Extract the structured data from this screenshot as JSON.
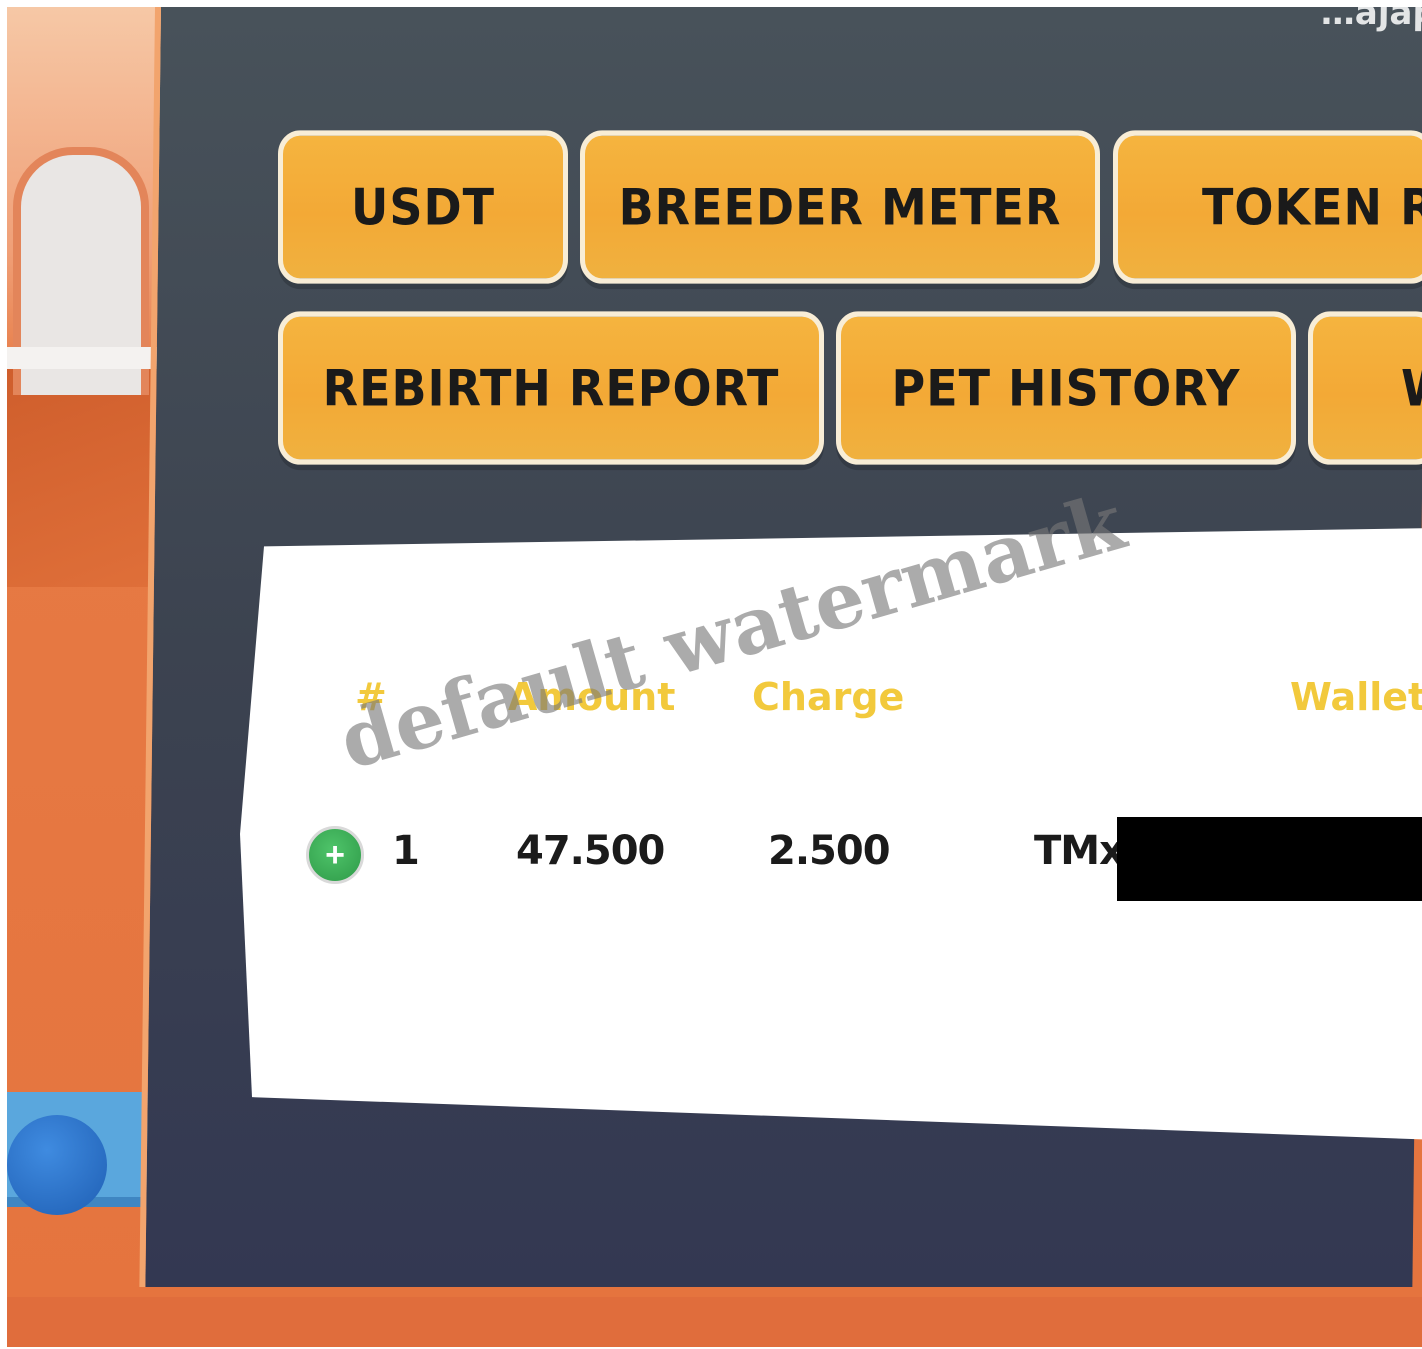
{
  "panel": {
    "title": "…ajapaci…"
  },
  "tabs": {
    "row1": [
      {
        "label": "USDT"
      },
      {
        "label": "BREEDER METER"
      },
      {
        "label": "TOKEN REP"
      }
    ],
    "row2": [
      {
        "label": "REBIRTH REPORT"
      },
      {
        "label": "PET HISTORY"
      },
      {
        "label": "W"
      }
    ]
  },
  "table": {
    "headers": {
      "index": "#",
      "amount": "Amount",
      "charge": "Charge",
      "wallet": "Wallet"
    },
    "rows": [
      {
        "expand_icon": "+",
        "index": "1",
        "amount": "47.500",
        "charge": "2.500",
        "wallet": "TMx"
      }
    ]
  },
  "watermark": "default watermark",
  "colors": {
    "tab_bg": "#f3a936",
    "tab_border": "#f8edd6",
    "header_text": "#f2c93c",
    "panel_bg": "#3c4350",
    "expand_button": "#3cae55"
  },
  "icons": {
    "expand": "plus-circle-icon"
  }
}
